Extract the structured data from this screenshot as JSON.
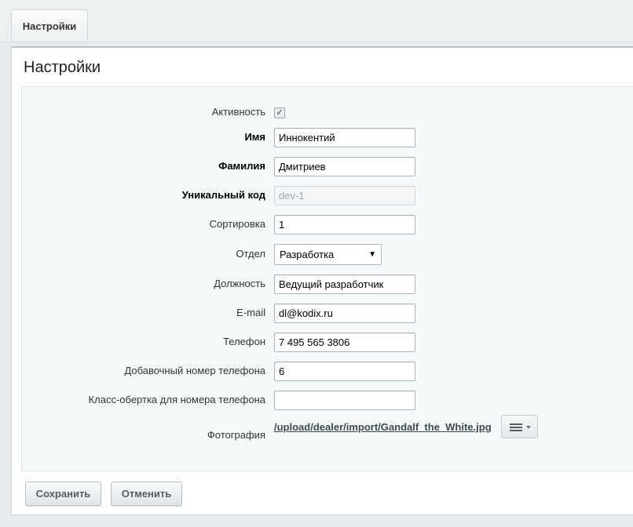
{
  "tabs": [
    {
      "label": "Настройки"
    }
  ],
  "panel": {
    "title": "Настройки"
  },
  "form": {
    "active": {
      "label": "Активность",
      "checked": true,
      "check_glyph": "✓"
    },
    "first_name": {
      "label": "Имя",
      "value": "Иннокентий"
    },
    "last_name": {
      "label": "Фамилия",
      "value": "Дмитриев"
    },
    "code": {
      "label": "Уникальный код",
      "value": "dev-1"
    },
    "sort": {
      "label": "Сортировка",
      "value": "1"
    },
    "department": {
      "label": "Отдел",
      "value": "Разработка"
    },
    "position": {
      "label": "Должность",
      "value": "Ведущий разработчик"
    },
    "email": {
      "label": "E-mail",
      "value": "dl@kodix.ru"
    },
    "phone": {
      "label": "Телефон",
      "value": "7 495 565 3806"
    },
    "ext": {
      "label": "Добавочный номер телефона",
      "value": "6"
    },
    "wrapper_class": {
      "label": "Класс-обертка для номера телефона",
      "value": ""
    },
    "photo": {
      "label": "Фотография",
      "path": "/upload/dealer/import/Gandalf_the_White.jpg"
    }
  },
  "buttons": {
    "save": "Сохранить",
    "cancel": "Отменить"
  }
}
